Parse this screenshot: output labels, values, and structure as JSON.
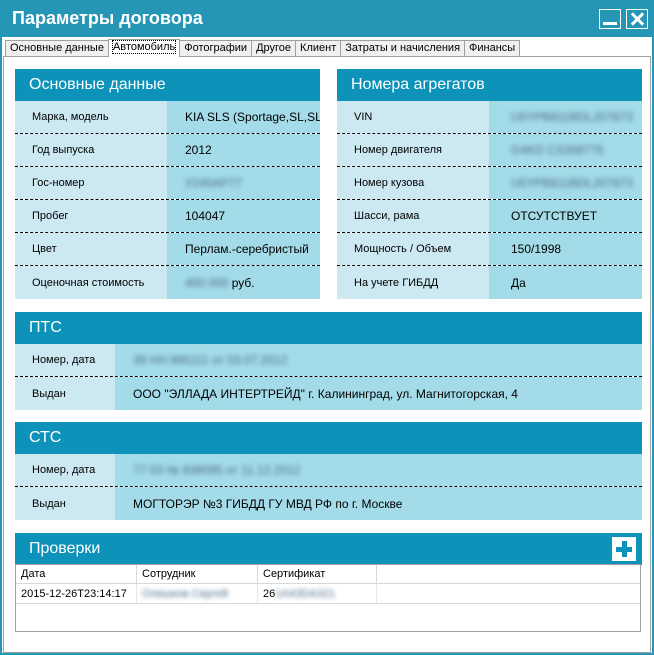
{
  "window": {
    "title": "Параметры договора"
  },
  "tabs": [
    "Основные данные",
    "Автомобиль",
    "Фотографии",
    "Другое",
    "Клиент",
    "Затраты и начисления",
    "Финансы"
  ],
  "active_tab": "Автомобиль",
  "basic": {
    "title": "Основные данные",
    "rows": [
      {
        "label": "Марка, модель",
        "value": "KIA SLS (Sportage,SL,SLS)"
      },
      {
        "label": "Год выпуска",
        "value": "2012"
      },
      {
        "label": "Гос-номер",
        "value": "У245АР77"
      },
      {
        "label": "Пробег",
        "value": "104047"
      },
      {
        "label": "Цвет",
        "value": "Перлам.-серебристый"
      },
      {
        "label": "Оценочная стоимость",
        "value": "400 000",
        "suffix": "руб."
      }
    ]
  },
  "units": {
    "title": "Номера агрегатов",
    "rows": [
      {
        "label": "VIN",
        "value": "U5YPB811BDL207873"
      },
      {
        "label": "Номер двигателя",
        "value": "G4KD CS308775"
      },
      {
        "label": "Номер кузова",
        "value": "U5YPB811BDL207873"
      },
      {
        "label": "Шасси, рама",
        "value": "ОТСУТСТВУЕТ"
      },
      {
        "label": "Мощность / Объем",
        "value": "150/1998"
      },
      {
        "label": "На учете ГИБДД",
        "value": "Да"
      }
    ]
  },
  "pts": {
    "title": "ПТС",
    "rows": [
      {
        "label": "Номер, дата",
        "value": "39 НН 885111 от 03.07.2012"
      },
      {
        "label": "Выдан",
        "value": "ООО \"ЭЛЛАДА ИНТЕРТРЕЙД\" г. Калининград, ул. Магнитогорская, 4"
      }
    ]
  },
  "sts": {
    "title": "СТС",
    "rows": [
      {
        "label": "Номер, дата",
        "value": "77 03 № 838095 от 11.12.2012"
      },
      {
        "label": "Выдан",
        "value": "МОГТОРЭР №3 ГИБДД ГУ МВД РФ по г. Москве"
      }
    ]
  },
  "checks": {
    "title": "Проверки",
    "columns": [
      "Дата",
      "Сотрудник",
      "Сертификат"
    ],
    "rows": [
      {
        "date": "2015-12-26T23:14:17",
        "employee": "Олешков Сергей",
        "cert_prefix": "26",
        "cert_rest": "1А4ЗDА321"
      }
    ]
  },
  "colors": {
    "accent": "#0d93ba",
    "label_bg": "#cce9f2",
    "value_bg": "#a3dbe8",
    "frame": "#2596b6"
  }
}
